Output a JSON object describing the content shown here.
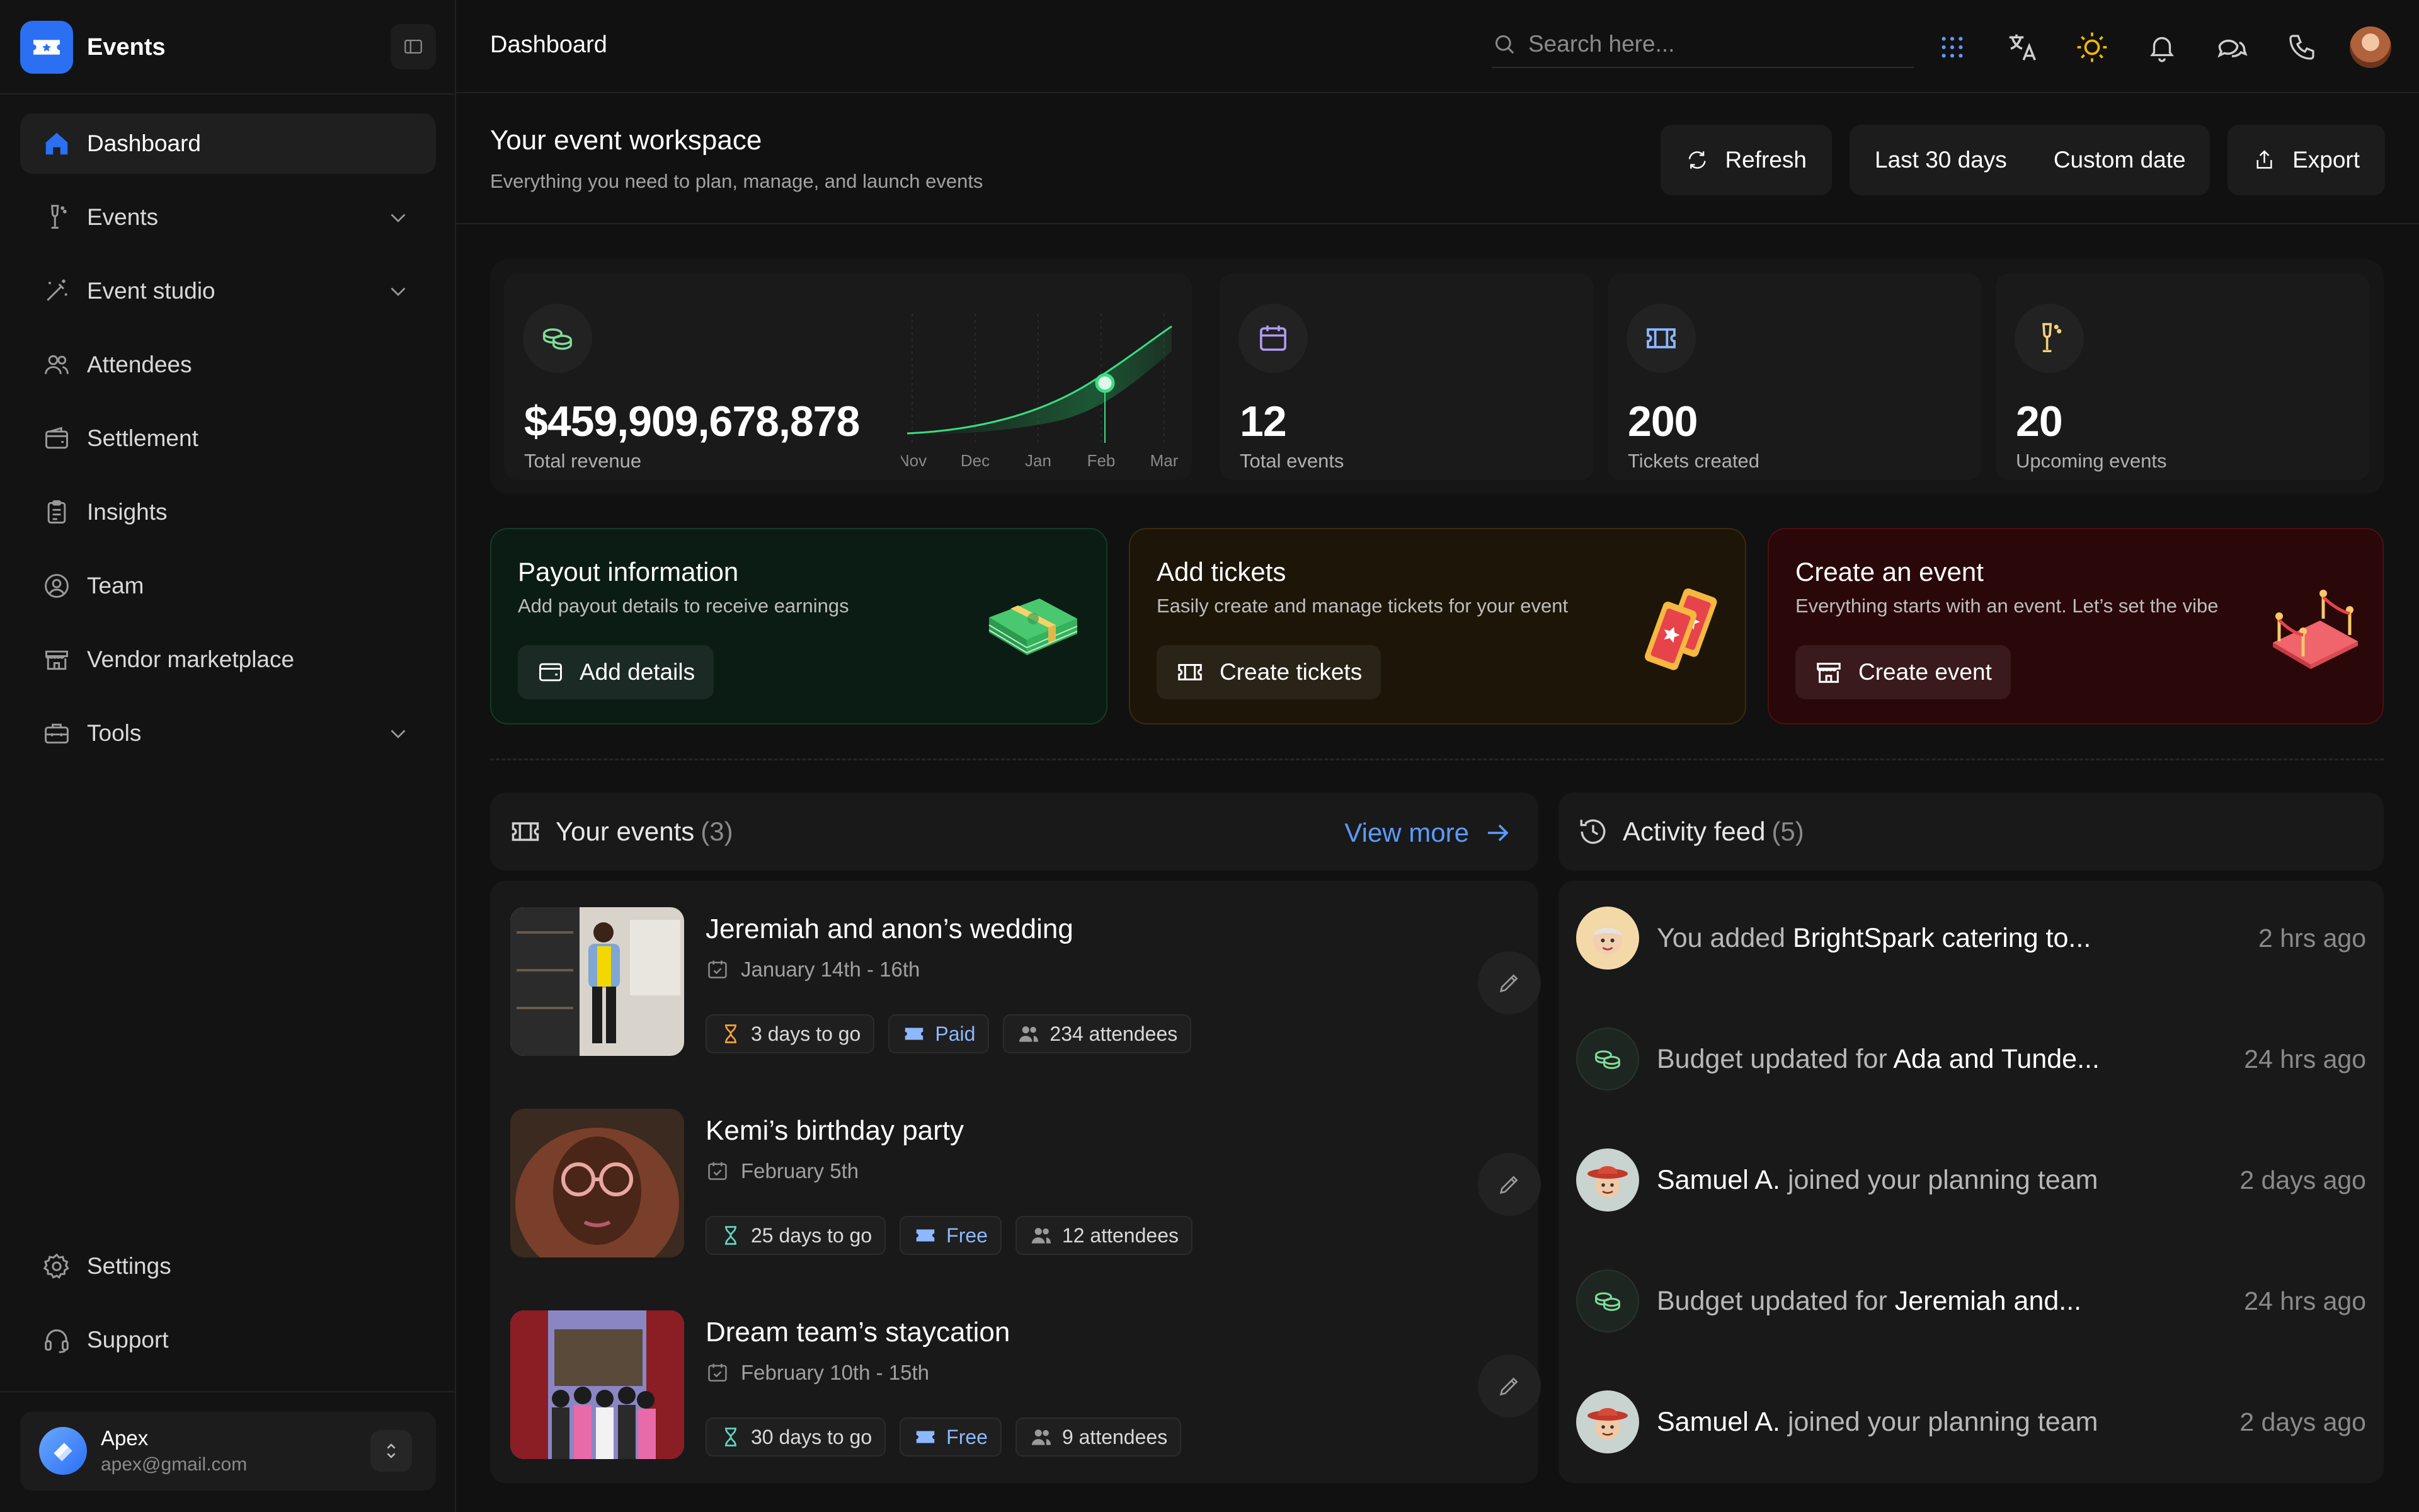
{
  "app": {
    "name": "Events"
  },
  "sidebar": {
    "items": [
      {
        "label": "Dashboard",
        "icon": "home-icon",
        "active": true
      },
      {
        "label": "Events",
        "icon": "champagne-icon",
        "expandable": true
      },
      {
        "label": "Event studio",
        "icon": "magic-wand-icon",
        "expandable": true
      },
      {
        "label": "Attendees",
        "icon": "users-icon"
      },
      {
        "label": "Settlement",
        "icon": "wallet-icon"
      },
      {
        "label": "Insights",
        "icon": "clipboard-icon"
      },
      {
        "label": "Team",
        "icon": "user-circle-icon"
      },
      {
        "label": "Vendor marketplace",
        "icon": "store-icon"
      },
      {
        "label": "Tools",
        "icon": "toolbox-icon",
        "expandable": true
      }
    ],
    "bottom": [
      {
        "label": "Settings",
        "icon": "gear-icon"
      },
      {
        "label": "Support",
        "icon": "headset-icon"
      }
    ],
    "user": {
      "name": "Apex",
      "email": "apex@gmail.com"
    }
  },
  "topbar": {
    "title": "Dashboard",
    "search_placeholder": "Search here..."
  },
  "workspace": {
    "title": "Your event workspace",
    "subtitle": "Everything you need to plan, manage, and launch events",
    "refresh": "Refresh",
    "range": "Last 30 days",
    "custom": "Custom date",
    "export": "Export"
  },
  "stats": {
    "revenue": {
      "value": "$459,909,678,878",
      "label": "Total revenue",
      "months": [
        "Nov",
        "Dec",
        "Jan",
        "Feb",
        "Mar"
      ]
    },
    "events": {
      "value": "12",
      "label": "Total events"
    },
    "tickets": {
      "value": "200",
      "label": "Tickets created"
    },
    "upcoming": {
      "value": "20",
      "label": "Upcoming events"
    }
  },
  "actions": {
    "payout": {
      "title": "Payout information",
      "subtitle": "Add payout details to receive earnings",
      "button": "Add details"
    },
    "tickets": {
      "title": "Add tickets",
      "subtitle": "Easily create and manage tickets for your event",
      "button": "Create tickets"
    },
    "create": {
      "title": "Create an event",
      "subtitle": "Everything starts with an event. Let’s set the vibe",
      "button": "Create event"
    }
  },
  "events_panel": {
    "title": "Your events",
    "count": "(3)",
    "view_more": "View more",
    "events": [
      {
        "name": "Jeremiah and anon’s wedding",
        "date": "January 14th - 16th",
        "countdown": "3 days to go",
        "price": "Paid",
        "attendees": "234 attendees"
      },
      {
        "name": "Kemi’s birthday party",
        "date": "February 5th",
        "countdown": "25 days to go",
        "price": "Free",
        "attendees": "12 attendees"
      },
      {
        "name": "Dream team’s staycation",
        "date": "February 10th - 15th",
        "countdown": "30 days to go",
        "price": "Free",
        "attendees": "9 attendees"
      }
    ]
  },
  "activity_panel": {
    "title": "Activity feed",
    "count": "(5)",
    "items": [
      {
        "prefix": "You added ",
        "bold": "BrightSpark catering to...",
        "suffix": "",
        "time": "2 hrs ago",
        "avatar": "memoji-avatar"
      },
      {
        "prefix": "Budget updated for ",
        "bold": "Ada and Tunde...",
        "suffix": "",
        "time": "24 hrs ago",
        "avatar": "coins-icon"
      },
      {
        "prefix": "",
        "bold": "Samuel A.",
        "suffix": " joined your planning team",
        "time": "2 days ago",
        "avatar": "cowboy-avatar"
      },
      {
        "prefix": "Budget updated for ",
        "bold": "Jeremiah and...",
        "suffix": "",
        "time": "24 hrs ago",
        "avatar": "coins-icon"
      },
      {
        "prefix": "",
        "bold": "Samuel A.",
        "suffix": " joined your planning team",
        "time": "2 days ago",
        "avatar": "cowboy-avatar"
      }
    ]
  },
  "colors": {
    "accent": "#2b6ff3",
    "link": "#5b9bff",
    "chart_green": "#3ddc84",
    "payout_bg": "#0b1c15",
    "tickets_bg": "#1d1507",
    "create_bg": "#2a0708"
  }
}
